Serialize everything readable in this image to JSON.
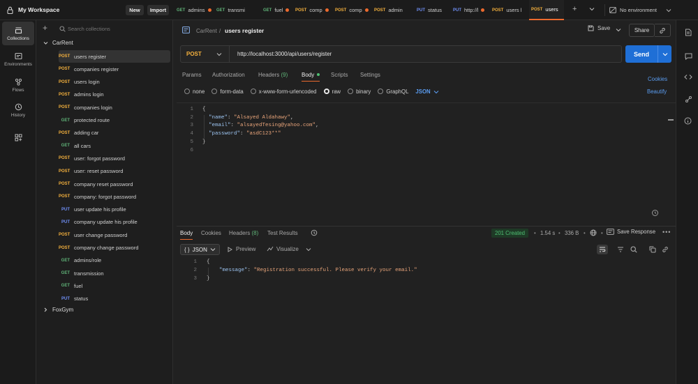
{
  "workspace": {
    "title": "My Workspace",
    "new_label": "New",
    "import_label": "Import"
  },
  "tabs": [
    {
      "method": "GET",
      "label": "admins",
      "dot": true
    },
    {
      "method": "GET",
      "label": "transmi",
      "dot": false
    },
    {
      "method": "GET",
      "label": "fuel",
      "dot": true
    },
    {
      "method": "POST",
      "label": "comp",
      "dot": true
    },
    {
      "method": "POST",
      "label": "comp",
      "dot": true
    },
    {
      "method": "POST",
      "label": "admin",
      "dot": false
    },
    {
      "method": "PUT",
      "label": "status",
      "dot": false
    },
    {
      "method": "PUT",
      "label": "http://l",
      "dot": true
    },
    {
      "method": "POST",
      "label": "users l",
      "dot": false
    },
    {
      "method": "POST",
      "label": "users",
      "dot": false
    }
  ],
  "environment": {
    "label": "No environment"
  },
  "rail": {
    "collections": "Collections",
    "environments": "Environments",
    "flows": "Flows",
    "history": "History"
  },
  "sidebar": {
    "search_placeholder": "Search collections",
    "collection_name": "CarRent",
    "requests": [
      {
        "method": "POST",
        "name": "users register"
      },
      {
        "method": "POST",
        "name": "companies register"
      },
      {
        "method": "POST",
        "name": "users login"
      },
      {
        "method": "POST",
        "name": "admins login"
      },
      {
        "method": "POST",
        "name": "companies login"
      },
      {
        "method": "GET",
        "name": "protected route"
      },
      {
        "method": "POST",
        "name": "adding car"
      },
      {
        "method": "GET",
        "name": "all cars"
      },
      {
        "method": "POST",
        "name": "user: forgot password"
      },
      {
        "method": "POST",
        "name": "user: reset password"
      },
      {
        "method": "POST",
        "name": "company reset password"
      },
      {
        "method": "POST",
        "name": "company: forgot password"
      },
      {
        "method": "PUT",
        "name": "user update his profile"
      },
      {
        "method": "PUT",
        "name": "company update his profile"
      },
      {
        "method": "POST",
        "name": "user change password"
      },
      {
        "method": "POST",
        "name": "company change password"
      },
      {
        "method": "GET",
        "name": "admins/role"
      },
      {
        "method": "GET",
        "name": "transmission"
      },
      {
        "method": "GET",
        "name": "fuel"
      },
      {
        "method": "PUT",
        "name": "status"
      }
    ],
    "other_collection": "FoxGym"
  },
  "header": {
    "breadcrumb_parent": "CarRent",
    "breadcrumb_sep": "/",
    "title": "users register",
    "save_label": "Save",
    "share_label": "Share"
  },
  "request": {
    "method": "POST",
    "url": "http://localhost:3000/api/users/register",
    "send_label": "Send"
  },
  "request_tabs": {
    "params": "Params",
    "authorization": "Authorization",
    "headers": "Headers",
    "headers_count": "(9)",
    "body": "Body",
    "scripts": "Scripts",
    "settings": "Settings",
    "cookies": "Cookies",
    "beautify": "Beautify"
  },
  "body_types": {
    "none": "none",
    "form_data": "form-data",
    "urlencoded": "x-www-form-urlencoded",
    "raw": "raw",
    "binary": "binary",
    "graphql": "GraphQL",
    "format": "JSON"
  },
  "request_body": [
    {
      "n": "1",
      "text": "{"
    },
    {
      "n": "2",
      "key": "\"name\"",
      "value": "\"Alsayed Aldahawy\"",
      "comma": ","
    },
    {
      "n": "3",
      "key": "\"email\"",
      "value": "\"alsayedTesing@yahoo.com\"",
      "comma": ","
    },
    {
      "n": "4",
      "key": "\"password\"",
      "value": "\"asdC123**\"",
      "comma": ""
    },
    {
      "n": "5",
      "text": "}"
    },
    {
      "n": "6",
      "text": ""
    }
  ],
  "response": {
    "tabs": {
      "body": "Body",
      "cookies": "Cookies",
      "headers": "Headers",
      "headers_count": "(8)",
      "tests": "Test Results"
    },
    "status": "201 Created",
    "time": "1.54 s",
    "size": "336 B",
    "save_label": "Save Response",
    "format": "JSON",
    "preview": "Preview",
    "visualize": "Visualize",
    "lines": [
      {
        "n": "1",
        "text": "{"
      },
      {
        "n": "2",
        "key": "\"message\"",
        "value": "\"Registration successful. Please verify your email.\""
      },
      {
        "n": "3",
        "text": "}"
      }
    ]
  },
  "colors": {
    "accent": "#ec6a2e",
    "send": "#1f6fd6",
    "post": "#f5b13d",
    "get": "#5fb277",
    "put": "#6f8ff5",
    "success": "#4fbf73"
  }
}
